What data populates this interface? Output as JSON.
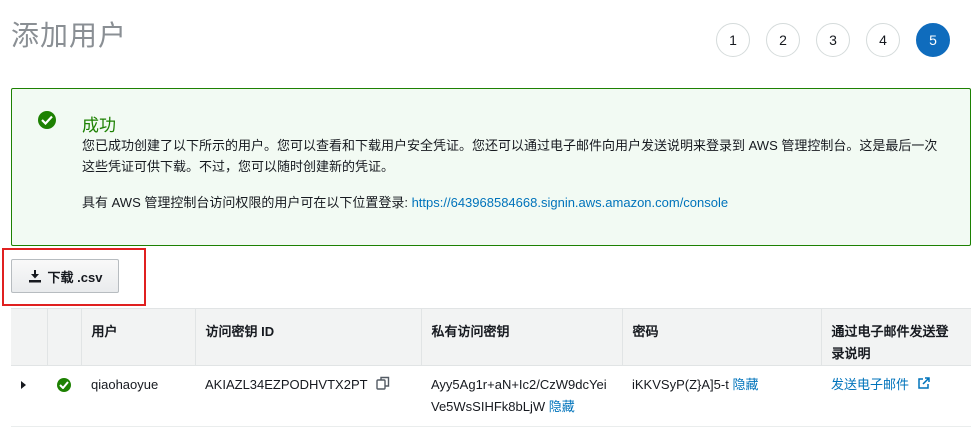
{
  "page": {
    "title": "添加用户"
  },
  "steps": [
    "1",
    "2",
    "3",
    "4",
    "5"
  ],
  "alert": {
    "title": "成功",
    "message": "您已成功创建了以下所示的用户。您可以查看和下载用户安全凭证。您还可以通过电子邮件向用户发送说明来登录到 AWS 管理控制台。这是最后一次这些凭证可供下载。不过，您可以随时创建新的凭证。",
    "url_prefix": "具有 AWS 管理控制台访问权限的用户可在以下位置登录: ",
    "url": "https://643968584668.signin.aws.amazon.com/console"
  },
  "download": {
    "label": "下载 .csv"
  },
  "table": {
    "headers": {
      "user": "用户",
      "access_key_id": "访问密钥 ID",
      "secret_key": "私有访问密钥",
      "password": "密码",
      "email": "通过电子邮件发送登录说明"
    },
    "row": {
      "user": "qiaohaoyue",
      "access_key_id": "AKIAZL34EZPODHVTX2PT",
      "secret_key": "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",
      "secret_hide": "隐藏",
      "password": "iKKVSyP(Z}A]5-t",
      "password_hide": "隐藏",
      "email_link": "发送电子邮件"
    }
  },
  "colors": {
    "success": "#1d8102",
    "link": "#0073bb",
    "highlight": "#e02020",
    "active_step": "#0f6cbd"
  }
}
